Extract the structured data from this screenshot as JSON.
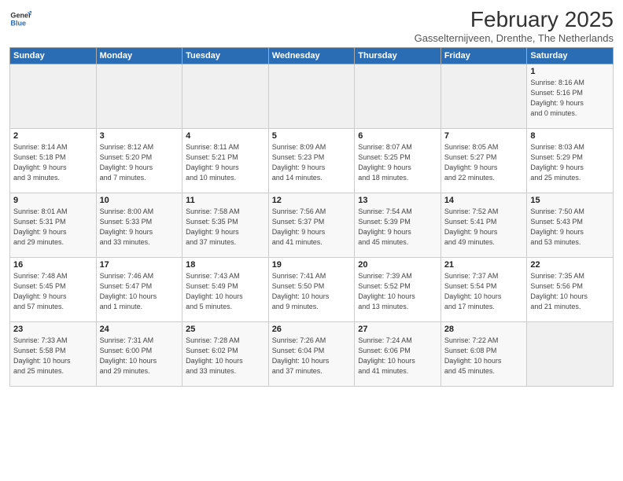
{
  "logo": {
    "line1": "General",
    "line2": "Blue"
  },
  "title": "February 2025",
  "subtitle": "Gasselternijveen, Drenthe, The Netherlands",
  "days_of_week": [
    "Sunday",
    "Monday",
    "Tuesday",
    "Wednesday",
    "Thursday",
    "Friday",
    "Saturday"
  ],
  "weeks": [
    [
      {
        "day": "",
        "info": ""
      },
      {
        "day": "",
        "info": ""
      },
      {
        "day": "",
        "info": ""
      },
      {
        "day": "",
        "info": ""
      },
      {
        "day": "",
        "info": ""
      },
      {
        "day": "",
        "info": ""
      },
      {
        "day": "1",
        "info": "Sunrise: 8:16 AM\nSunset: 5:16 PM\nDaylight: 9 hours\nand 0 minutes."
      }
    ],
    [
      {
        "day": "2",
        "info": "Sunrise: 8:14 AM\nSunset: 5:18 PM\nDaylight: 9 hours\nand 3 minutes."
      },
      {
        "day": "3",
        "info": "Sunrise: 8:12 AM\nSunset: 5:20 PM\nDaylight: 9 hours\nand 7 minutes."
      },
      {
        "day": "4",
        "info": "Sunrise: 8:11 AM\nSunset: 5:21 PM\nDaylight: 9 hours\nand 10 minutes."
      },
      {
        "day": "5",
        "info": "Sunrise: 8:09 AM\nSunset: 5:23 PM\nDaylight: 9 hours\nand 14 minutes."
      },
      {
        "day": "6",
        "info": "Sunrise: 8:07 AM\nSunset: 5:25 PM\nDaylight: 9 hours\nand 18 minutes."
      },
      {
        "day": "7",
        "info": "Sunrise: 8:05 AM\nSunset: 5:27 PM\nDaylight: 9 hours\nand 22 minutes."
      },
      {
        "day": "8",
        "info": "Sunrise: 8:03 AM\nSunset: 5:29 PM\nDaylight: 9 hours\nand 25 minutes."
      }
    ],
    [
      {
        "day": "9",
        "info": "Sunrise: 8:01 AM\nSunset: 5:31 PM\nDaylight: 9 hours\nand 29 minutes."
      },
      {
        "day": "10",
        "info": "Sunrise: 8:00 AM\nSunset: 5:33 PM\nDaylight: 9 hours\nand 33 minutes."
      },
      {
        "day": "11",
        "info": "Sunrise: 7:58 AM\nSunset: 5:35 PM\nDaylight: 9 hours\nand 37 minutes."
      },
      {
        "day": "12",
        "info": "Sunrise: 7:56 AM\nSunset: 5:37 PM\nDaylight: 9 hours\nand 41 minutes."
      },
      {
        "day": "13",
        "info": "Sunrise: 7:54 AM\nSunset: 5:39 PM\nDaylight: 9 hours\nand 45 minutes."
      },
      {
        "day": "14",
        "info": "Sunrise: 7:52 AM\nSunset: 5:41 PM\nDaylight: 9 hours\nand 49 minutes."
      },
      {
        "day": "15",
        "info": "Sunrise: 7:50 AM\nSunset: 5:43 PM\nDaylight: 9 hours\nand 53 minutes."
      }
    ],
    [
      {
        "day": "16",
        "info": "Sunrise: 7:48 AM\nSunset: 5:45 PM\nDaylight: 9 hours\nand 57 minutes."
      },
      {
        "day": "17",
        "info": "Sunrise: 7:46 AM\nSunset: 5:47 PM\nDaylight: 10 hours\nand 1 minute."
      },
      {
        "day": "18",
        "info": "Sunrise: 7:43 AM\nSunset: 5:49 PM\nDaylight: 10 hours\nand 5 minutes."
      },
      {
        "day": "19",
        "info": "Sunrise: 7:41 AM\nSunset: 5:50 PM\nDaylight: 10 hours\nand 9 minutes."
      },
      {
        "day": "20",
        "info": "Sunrise: 7:39 AM\nSunset: 5:52 PM\nDaylight: 10 hours\nand 13 minutes."
      },
      {
        "day": "21",
        "info": "Sunrise: 7:37 AM\nSunset: 5:54 PM\nDaylight: 10 hours\nand 17 minutes."
      },
      {
        "day": "22",
        "info": "Sunrise: 7:35 AM\nSunset: 5:56 PM\nDaylight: 10 hours\nand 21 minutes."
      }
    ],
    [
      {
        "day": "23",
        "info": "Sunrise: 7:33 AM\nSunset: 5:58 PM\nDaylight: 10 hours\nand 25 minutes."
      },
      {
        "day": "24",
        "info": "Sunrise: 7:31 AM\nSunset: 6:00 PM\nDaylight: 10 hours\nand 29 minutes."
      },
      {
        "day": "25",
        "info": "Sunrise: 7:28 AM\nSunset: 6:02 PM\nDaylight: 10 hours\nand 33 minutes."
      },
      {
        "day": "26",
        "info": "Sunrise: 7:26 AM\nSunset: 6:04 PM\nDaylight: 10 hours\nand 37 minutes."
      },
      {
        "day": "27",
        "info": "Sunrise: 7:24 AM\nSunset: 6:06 PM\nDaylight: 10 hours\nand 41 minutes."
      },
      {
        "day": "28",
        "info": "Sunrise: 7:22 AM\nSunset: 6:08 PM\nDaylight: 10 hours\nand 45 minutes."
      },
      {
        "day": "",
        "info": ""
      }
    ]
  ]
}
